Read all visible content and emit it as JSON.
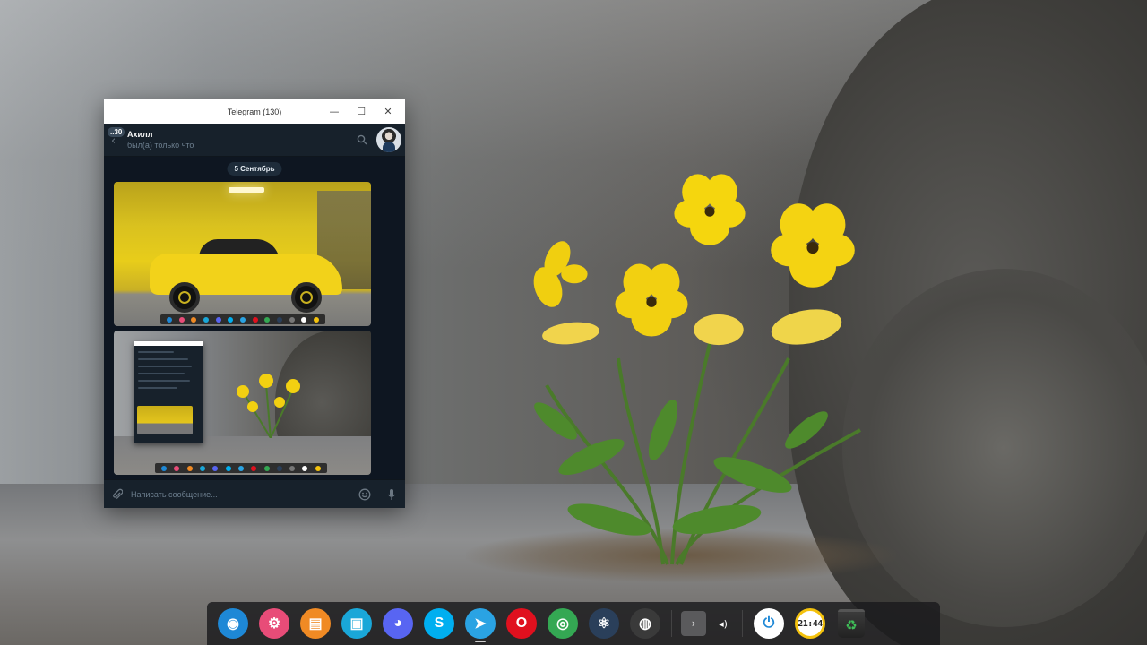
{
  "telegram": {
    "window_title": "Telegram (130)",
    "controls": {
      "minimize": "—",
      "maximize": "☐",
      "close": "✕"
    },
    "unread_badge": "..30",
    "peer_name": "Ахилл",
    "peer_status": "был(а) только что",
    "date_separator": "5 Сентябрь",
    "input_placeholder": "Написать сообщение..."
  },
  "dock": {
    "apps": [
      {
        "name": "deepin-launcher",
        "color": "#1e88d6",
        "glyph": "◉",
        "running": false
      },
      {
        "name": "settings",
        "color": "#e84c78",
        "glyph": "⚙",
        "running": false
      },
      {
        "name": "app-store",
        "color": "#f08a24",
        "glyph": "▤",
        "running": false
      },
      {
        "name": "file-manager",
        "color": "#1aa7d8",
        "glyph": "▣",
        "running": false
      },
      {
        "name": "discord",
        "color": "#5865f2",
        "glyph": "◕",
        "running": false
      },
      {
        "name": "skype",
        "color": "#00aff0",
        "glyph": "S",
        "running": false
      },
      {
        "name": "telegram",
        "color": "#2aa3e3",
        "glyph": "➤",
        "running": true
      },
      {
        "name": "opera",
        "color": "#e0101e",
        "glyph": "O",
        "running": false
      },
      {
        "name": "chrome",
        "color": "#34a853",
        "glyph": "◎",
        "running": false
      },
      {
        "name": "steam",
        "color": "#2a3f5a",
        "glyph": "⚛",
        "running": false
      },
      {
        "name": "obs",
        "color": "#3a3a3a",
        "glyph": "◍",
        "running": false
      }
    ],
    "tray_expand": "›",
    "volume": "◂)",
    "power": "⏻",
    "clock_time": "21:44",
    "trash": "♻"
  }
}
